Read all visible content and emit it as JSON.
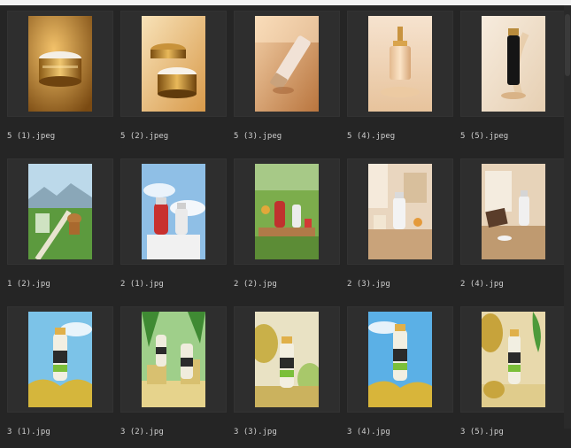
{
  "files": [
    {
      "name": "5 (1).jpeg",
      "thumb": "gold-jar"
    },
    {
      "name": "5 (2).jpeg",
      "thumb": "gold-jar-open"
    },
    {
      "name": "5 (3).jpeg",
      "thumb": "tube"
    },
    {
      "name": "5 (4).jpeg",
      "thumb": "foundation"
    },
    {
      "name": "5 (5).jpeg",
      "thumb": "black-tube"
    },
    {
      "name": "1 (2).jpg",
      "thumb": "landscape-cat"
    },
    {
      "name": "2 (1).jpg",
      "thumb": "kettle-sky"
    },
    {
      "name": "2 (2).jpg",
      "thumb": "kettle-grass"
    },
    {
      "name": "2 (3).jpg",
      "thumb": "kettle-room"
    },
    {
      "name": "2 (4).jpg",
      "thumb": "kettle-desk"
    },
    {
      "name": "3 (1).jpg",
      "thumb": "durian-drink-sky"
    },
    {
      "name": "3 (2).jpg",
      "thumb": "durian-drink-stage"
    },
    {
      "name": "3 (3).jpg",
      "thumb": "durian-drink-fruit"
    },
    {
      "name": "3 (4).jpg",
      "thumb": "durian-drink-sky2"
    },
    {
      "name": "3 (5).jpg",
      "thumb": "durian-drink-sand"
    }
  ]
}
